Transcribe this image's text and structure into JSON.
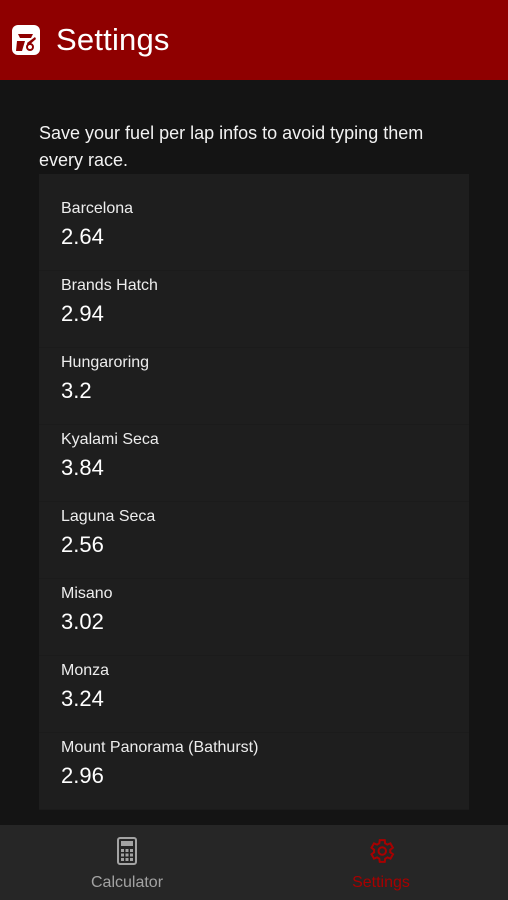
{
  "header": {
    "title": "Settings",
    "logo_icon": "fuel-app-logo-icon",
    "color": "#8f0000"
  },
  "main": {
    "intro_text": "Save your fuel per lap infos to avoid typing them every race.",
    "tracks": [
      {
        "name": "Barcelona",
        "value": "2.64"
      },
      {
        "name": "Brands Hatch",
        "value": "2.94"
      },
      {
        "name": "Hungaroring",
        "value": "3.2"
      },
      {
        "name": "Kyalami Seca",
        "value": "3.84"
      },
      {
        "name": "Laguna Seca",
        "value": "2.56"
      },
      {
        "name": "Misano",
        "value": "3.02"
      },
      {
        "name": "Monza",
        "value": "3.24"
      },
      {
        "name": "Mount Panorama (Bathurst)",
        "value": "2.96"
      }
    ]
  },
  "bottom_nav": {
    "items": [
      {
        "label": "Calculator",
        "icon": "calculator-icon",
        "active": false
      },
      {
        "label": "Settings",
        "icon": "gear-icon",
        "active": true
      }
    ],
    "active_color": "#a80000",
    "inactive_color": "#a3a3a3"
  }
}
